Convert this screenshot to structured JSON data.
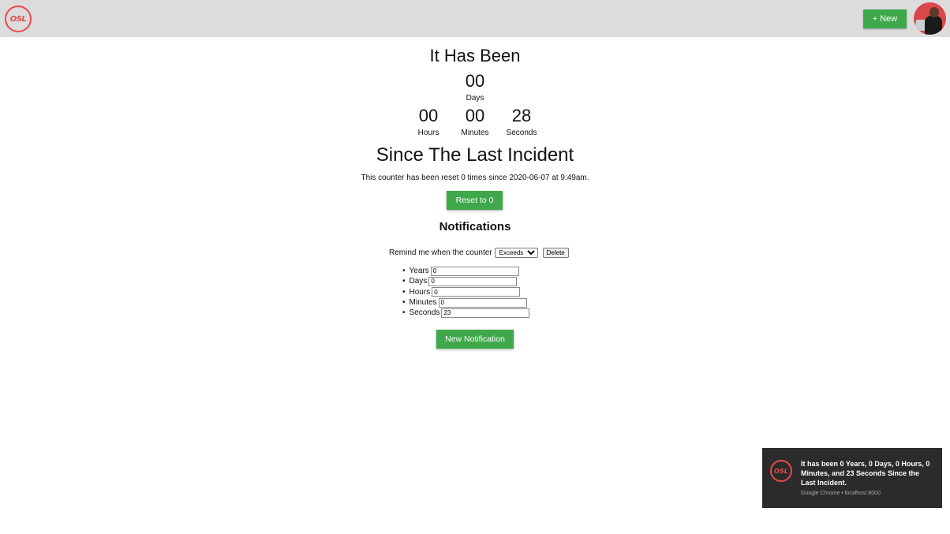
{
  "header": {
    "logo_text": "OSL",
    "new_button": "+ New"
  },
  "counter": {
    "heading_top": "It Has Been",
    "days": {
      "value": "00",
      "label": "Days"
    },
    "hours": {
      "value": "00",
      "label": "Hours"
    },
    "minutes": {
      "value": "00",
      "label": "Minutes"
    },
    "seconds": {
      "value": "28",
      "label": "Seconds"
    },
    "heading_bottom": "Since The Last Incident",
    "reset_info": "This counter has been reset 0 times since 2020-06-07 at 9:49am.",
    "reset_button": "Reset to 0"
  },
  "notifications": {
    "title": "Notifications",
    "remind_label": "Remind me when the counter",
    "condition_selected": "Exceeds",
    "delete_button": "Delete",
    "fields": [
      {
        "label": "Years",
        "value": "0"
      },
      {
        "label": "Days",
        "value": "0"
      },
      {
        "label": "Hours",
        "value": "0"
      },
      {
        "label": "Minutes",
        "value": "0"
      },
      {
        "label": "Seconds",
        "value": "23"
      }
    ],
    "new_button": "New Notification"
  },
  "toast": {
    "logo_text": "OSL",
    "message": "It has been 0 Years, 0 Days, 0 Hours, 0 Minutes, and 23 Seconds Since the Last Incident.",
    "source": "Google Chrome • localhost:8000"
  },
  "colors": {
    "accent_green": "#3ea84b",
    "logo_red": "#e84a4a",
    "topbar_bg": "#dcdcdc",
    "toast_bg": "#2b2b2b"
  }
}
